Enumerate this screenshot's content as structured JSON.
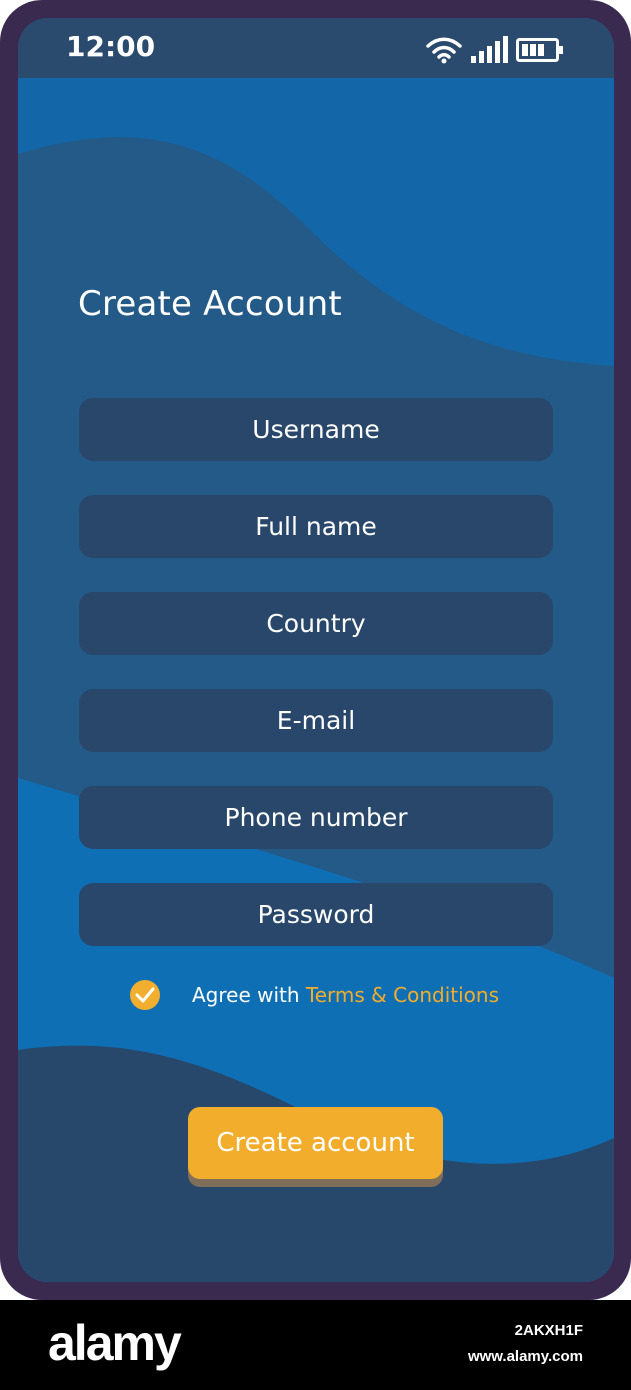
{
  "status_bar": {
    "time": "12:00",
    "icons": [
      "wifi-icon",
      "signal-icon",
      "battery-icon"
    ]
  },
  "screen": {
    "title": "Create Account",
    "fields": [
      {
        "placeholder": "Username"
      },
      {
        "placeholder": "Full name"
      },
      {
        "placeholder": "Country"
      },
      {
        "placeholder": "E-mail"
      },
      {
        "placeholder": "Phone number"
      },
      {
        "placeholder": "Password"
      }
    ],
    "agree": {
      "prefix": "Agree with",
      "link": "Terms & Conditions",
      "checked": true
    },
    "submit_label": "Create account"
  },
  "footer": {
    "logo": "alamy",
    "image_id": "2AKXH1F",
    "url": "www.alamy.com"
  },
  "colors": {
    "frame": "#3b2a4f",
    "field": "#28476b",
    "accent": "#f3ad2c",
    "screen_blue": "#0d6db3"
  }
}
